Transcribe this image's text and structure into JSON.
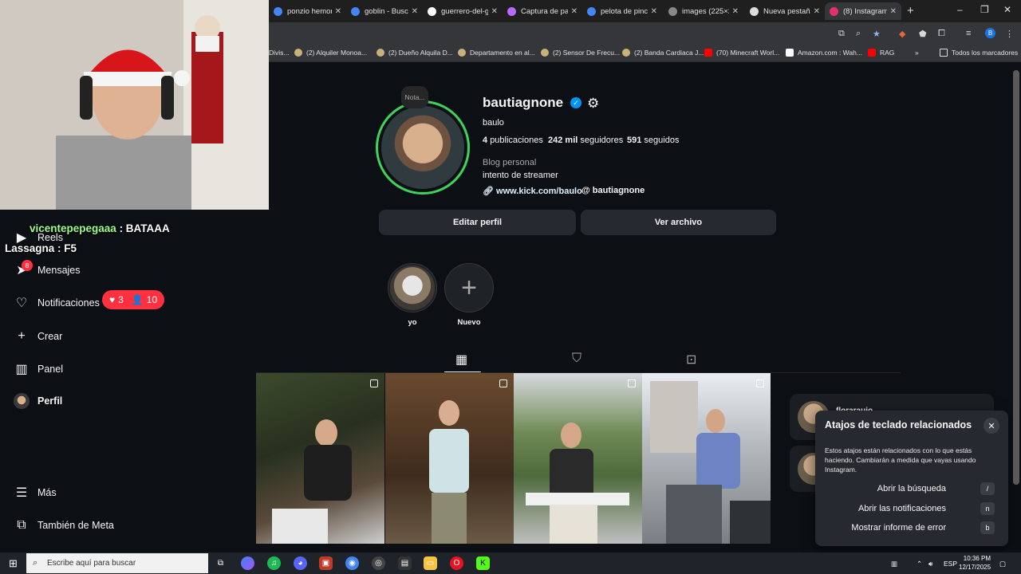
{
  "browser": {
    "tabs": [
      {
        "title": "ponzio hemon",
        "color": "#4285f4"
      },
      {
        "title": "goblin - Busca",
        "color": "#4285f4"
      },
      {
        "title": "guerrero-del-g",
        "color": "#ffffff"
      },
      {
        "title": "Captura de pa",
        "color": "#b86bff"
      },
      {
        "title": "pelota de pinc",
        "color": "#4285f4"
      },
      {
        "title": "images (225×2",
        "color": "#888888"
      },
      {
        "title": "Nueva pestaña",
        "color": "#dddddd"
      },
      {
        "title": "(8) Instagram",
        "color": "#e1306c"
      }
    ],
    "bookmarks": [
      "Divis...",
      "(2) Alquiler Monoa...",
      "(2) Dueño Alquila D...",
      "Departamento en al...",
      "(2) Sensor De Frecu...",
      "(2) Banda Cardiaca J...",
      "(70) Minecraft Worl...",
      "Amazon.com : Wah...",
      "RAG"
    ],
    "bookmarks_more": "Todos los marcadores"
  },
  "stream": {
    "chat": [
      {
        "user": "vicentepepegaaa",
        "text": " : BATAAA"
      },
      {
        "user": "Lassagna",
        "text": " : F5"
      }
    ]
  },
  "sidebar": {
    "items": [
      {
        "label": "Reels",
        "icon": "reels-icon"
      },
      {
        "label": "Mensajes",
        "icon": "messages-icon",
        "badge": "8"
      },
      {
        "label": "Notificaciones",
        "icon": "heart-icon"
      },
      {
        "label": "Crear",
        "icon": "plus-icon"
      },
      {
        "label": "Panel",
        "icon": "dashboard-icon"
      },
      {
        "label": "Perfil",
        "icon": "avatar"
      },
      {
        "label": "Más",
        "icon": "menu-icon"
      },
      {
        "label": "También de Meta",
        "icon": "meta-icon"
      }
    ],
    "notif_likes": "3",
    "notif_follows": "10"
  },
  "profile": {
    "note": "Nota...",
    "username": "bautiagnone",
    "name": "baulo",
    "posts_count": "4",
    "posts_label": "publicaciones",
    "followers_count": "242 mil",
    "followers_label": "seguidores",
    "following_count": "591",
    "following_label": "seguidos",
    "category": "Blog personal",
    "bio": "intento de streamer",
    "link": "www.kick.com/baulo",
    "threads": "bautiagnone",
    "edit_button": "Editar perfil",
    "archive_button": "Ver archivo",
    "highlights": [
      {
        "label": "yo"
      },
      {
        "label": "Nuevo"
      }
    ]
  },
  "suggestion": {
    "name": "florarauio"
  },
  "shortcuts_popup": {
    "title": "Atajos de teclado relacionados",
    "description": "Estos atajos están relacionados con lo que estás haciendo. Cambiarán a medida que vayas usando Instagram.",
    "items": [
      {
        "label": "Abrir la búsqueda",
        "key": "/"
      },
      {
        "label": "Abrir las notificaciones",
        "key": "n"
      },
      {
        "label": "Mostrar informe de error",
        "key": "b"
      }
    ]
  },
  "taskbar": {
    "search_placeholder": "Escribe aquí para buscar",
    "lang": "ESP",
    "time": "10:36 PM",
    "date": "12/17/2025"
  }
}
